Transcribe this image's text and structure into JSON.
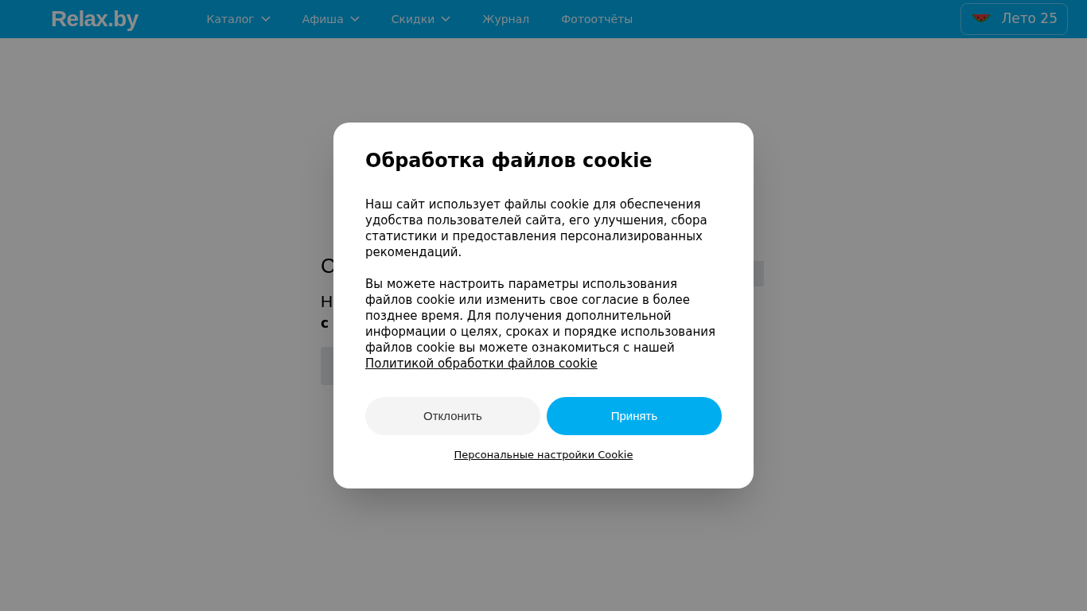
{
  "header": {
    "logo": "Relax.by",
    "nav": [
      {
        "label": "Каталог",
        "has_dropdown": true
      },
      {
        "label": "Афиша",
        "has_dropdown": true
      },
      {
        "label": "Скидки",
        "has_dropdown": true
      },
      {
        "label": "Журнал",
        "has_dropdown": false
      },
      {
        "label": "Фотоотчёты",
        "has_dropdown": false
      }
    ],
    "promo_button": {
      "label": "Лето 25"
    }
  },
  "background_page": {
    "heading": "С",
    "subheading": "Н",
    "text": "с"
  },
  "cookie_dialog": {
    "title": "Обработка файлов cookie",
    "paragraphs": [
      "Наш сайт использует файлы cookie для обеспечения удобства пользователей сайта, его улучшения, сбора статистики и предоставления персонализированных рекомендаций.",
      "Вы можете настроить параметры использования файлов cookie или изменить свое согласие в более позднее время. Для получения дополнительной информации о целях, сроках и порядке использования файлов cookie вы можете ознакомиться с нашей"
    ],
    "policy_link": "Политикой обработки файлов cookie",
    "buttons": [
      {
        "label": "Отклонить",
        "kind": "secondary"
      },
      {
        "label": "Принять",
        "kind": "primary"
      }
    ],
    "settings_link": "Персональные настройки Cookie"
  }
}
